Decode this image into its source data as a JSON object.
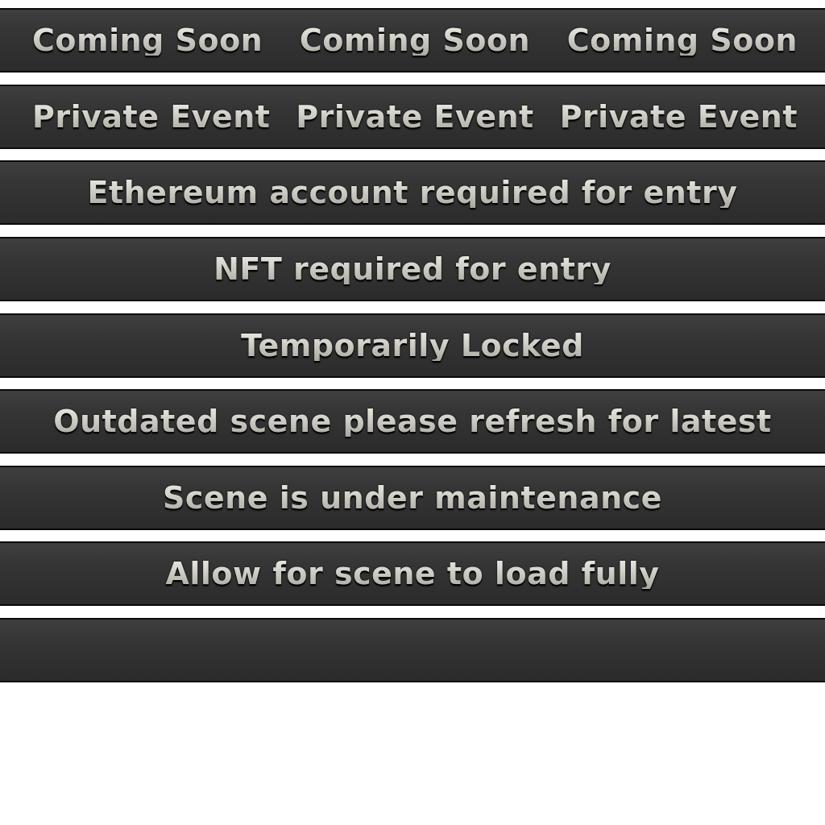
{
  "rows": [
    {
      "type": "triple",
      "labels": [
        "Coming Soon",
        "Coming Soon",
        "Coming Soon"
      ]
    },
    {
      "type": "triple",
      "labels": [
        "Private Event",
        "Private Event",
        "Private Event"
      ]
    },
    {
      "type": "single",
      "label": "Ethereum account required for entry"
    },
    {
      "type": "single",
      "label": "NFT required for entry"
    },
    {
      "type": "single",
      "label": "Temporarily Locked"
    },
    {
      "type": "single",
      "label": "Outdated scene please refresh for latest"
    },
    {
      "type": "single",
      "label": "Scene is under maintenance"
    },
    {
      "type": "single",
      "label": "Allow for scene to load fully"
    },
    {
      "type": "blank",
      "label": ""
    }
  ]
}
